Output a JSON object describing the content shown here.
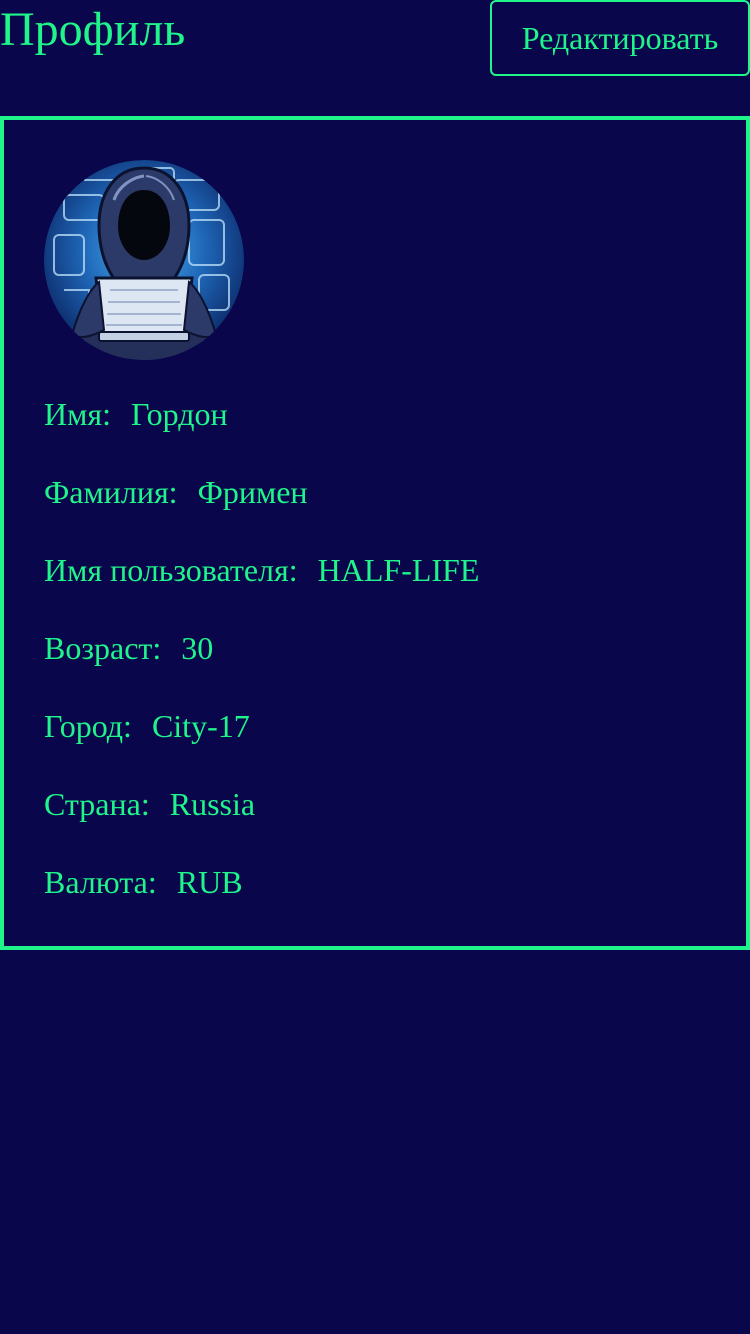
{
  "header": {
    "title": "Профиль",
    "edit_label": "Редактировать"
  },
  "profile": {
    "avatar_icon": "hooded-hacker-avatar",
    "fields": [
      {
        "label": "Имя:",
        "value": "Гордон"
      },
      {
        "label": "Фамилия:",
        "value": "Фримен"
      },
      {
        "label": "Имя пользователя:",
        "value": "HALF-LIFE"
      },
      {
        "label": "Возраст:",
        "value": "30"
      },
      {
        "label": "Город:",
        "value": "City-17"
      },
      {
        "label": "Страна:",
        "value": "Russia"
      },
      {
        "label": "Валюта:",
        "value": "RUB"
      }
    ]
  },
  "colors": {
    "background": "#0a064c",
    "accent": "#1ff58a"
  }
}
